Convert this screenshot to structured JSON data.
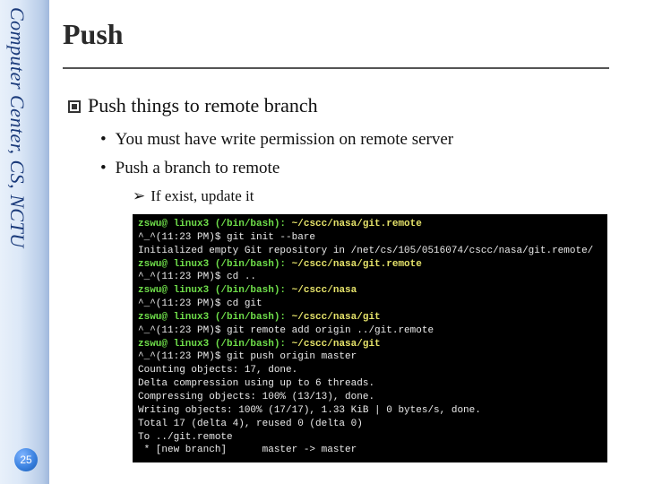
{
  "sidebar": {
    "label": "Computer Center, CS, NCTU"
  },
  "page_number": "25",
  "title": "Push",
  "heading": "Push things to remote branch",
  "bullets": {
    "a": "You must have write permission on remote server",
    "b": "Push a branch to remote",
    "b1": "If exist, update it"
  },
  "term": {
    "l1a": "zswu@ linux3 (/bin/bash): ",
    "l1b": "~/cscc/nasa/git.remote",
    "l2": "^_^(11:23 PM)$ git init --bare",
    "l3": "Initialized empty Git repository in /net/cs/105/0516074/cscc/nasa/git.remote/",
    "l4a": "zswu@ linux3 (/bin/bash): ",
    "l4b": "~/cscc/nasa/git.remote",
    "l5": "^_^(11:23 PM)$ cd ..",
    "l6a": "zswu@ linux3 (/bin/bash): ",
    "l6b": "~/cscc/nasa",
    "l7": "^_^(11:23 PM)$ cd git",
    "l8a": "zswu@ linux3 (/bin/bash): ",
    "l8b": "~/cscc/nasa/git",
    "l9": "^_^(11:23 PM)$ git remote add origin ../git.remote",
    "l10a": "zswu@ linux3 (/bin/bash): ",
    "l10b": "~/cscc/nasa/git",
    "l11": "^_^(11:23 PM)$ git push origin master",
    "l12": "Counting objects: 17, done.",
    "l13": "Delta compression using up to 6 threads.",
    "l14": "Compressing objects: 100% (13/13), done.",
    "l15": "Writing objects: 100% (17/17), 1.33 KiB | 0 bytes/s, done.",
    "l16": "Total 17 (delta 4), reused 0 (delta 0)",
    "l17": "To ../git.remote",
    "l18": " * [new branch]      master -> master"
  }
}
